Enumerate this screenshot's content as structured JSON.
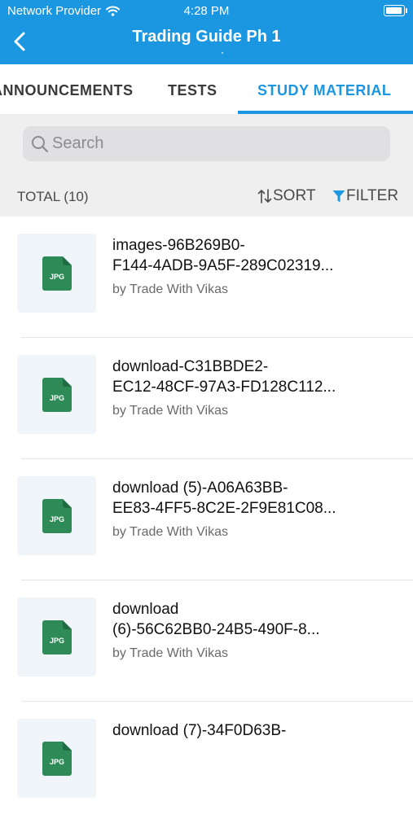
{
  "status_bar": {
    "carrier": "Network Provider",
    "time": "4:28 PM",
    "wifi_icon": "wifi-icon",
    "battery_icon": "battery-icon"
  },
  "header": {
    "title": "Trading Guide Ph 1",
    "back_icon": "chevron-left-icon",
    "background": "#1b96e0"
  },
  "tabs": [
    {
      "label": "ANNOUNCEMENTS",
      "active": false
    },
    {
      "label": "TESTS",
      "active": false
    },
    {
      "label": "STUDY MATERIAL",
      "active": true
    }
  ],
  "search": {
    "placeholder": "Search",
    "value": ""
  },
  "toolbar": {
    "total_label": "TOTAL (10)",
    "sort_label": "SORT",
    "filter_label": "FILTER"
  },
  "files": [
    {
      "line1": "images-96B269B0-",
      "line2": "F144-4ADB-9A5F-289C02319...",
      "author": "by Trade With Vikas",
      "type": "JPG"
    },
    {
      "line1": "download-C31BBDE2-",
      "line2": "EC12-48CF-97A3-FD128C112...",
      "author": "by Trade With Vikas",
      "type": "JPG"
    },
    {
      "line1": "download (5)-A06A63BB-",
      "line2": "EE83-4FF5-8C2E-2F9E81C08...",
      "author": "by Trade With Vikas",
      "type": "JPG"
    },
    {
      "line1": "download",
      "line2": "(6)-56C62BB0-24B5-490F-8...",
      "author": "by Trade With Vikas",
      "type": "JPG"
    },
    {
      "line1": "download (7)-34F0D63B-",
      "line2": "",
      "author": "",
      "type": "JPG"
    }
  ],
  "colors": {
    "accent": "#1b96e0",
    "file_icon": "#2e8b57"
  }
}
